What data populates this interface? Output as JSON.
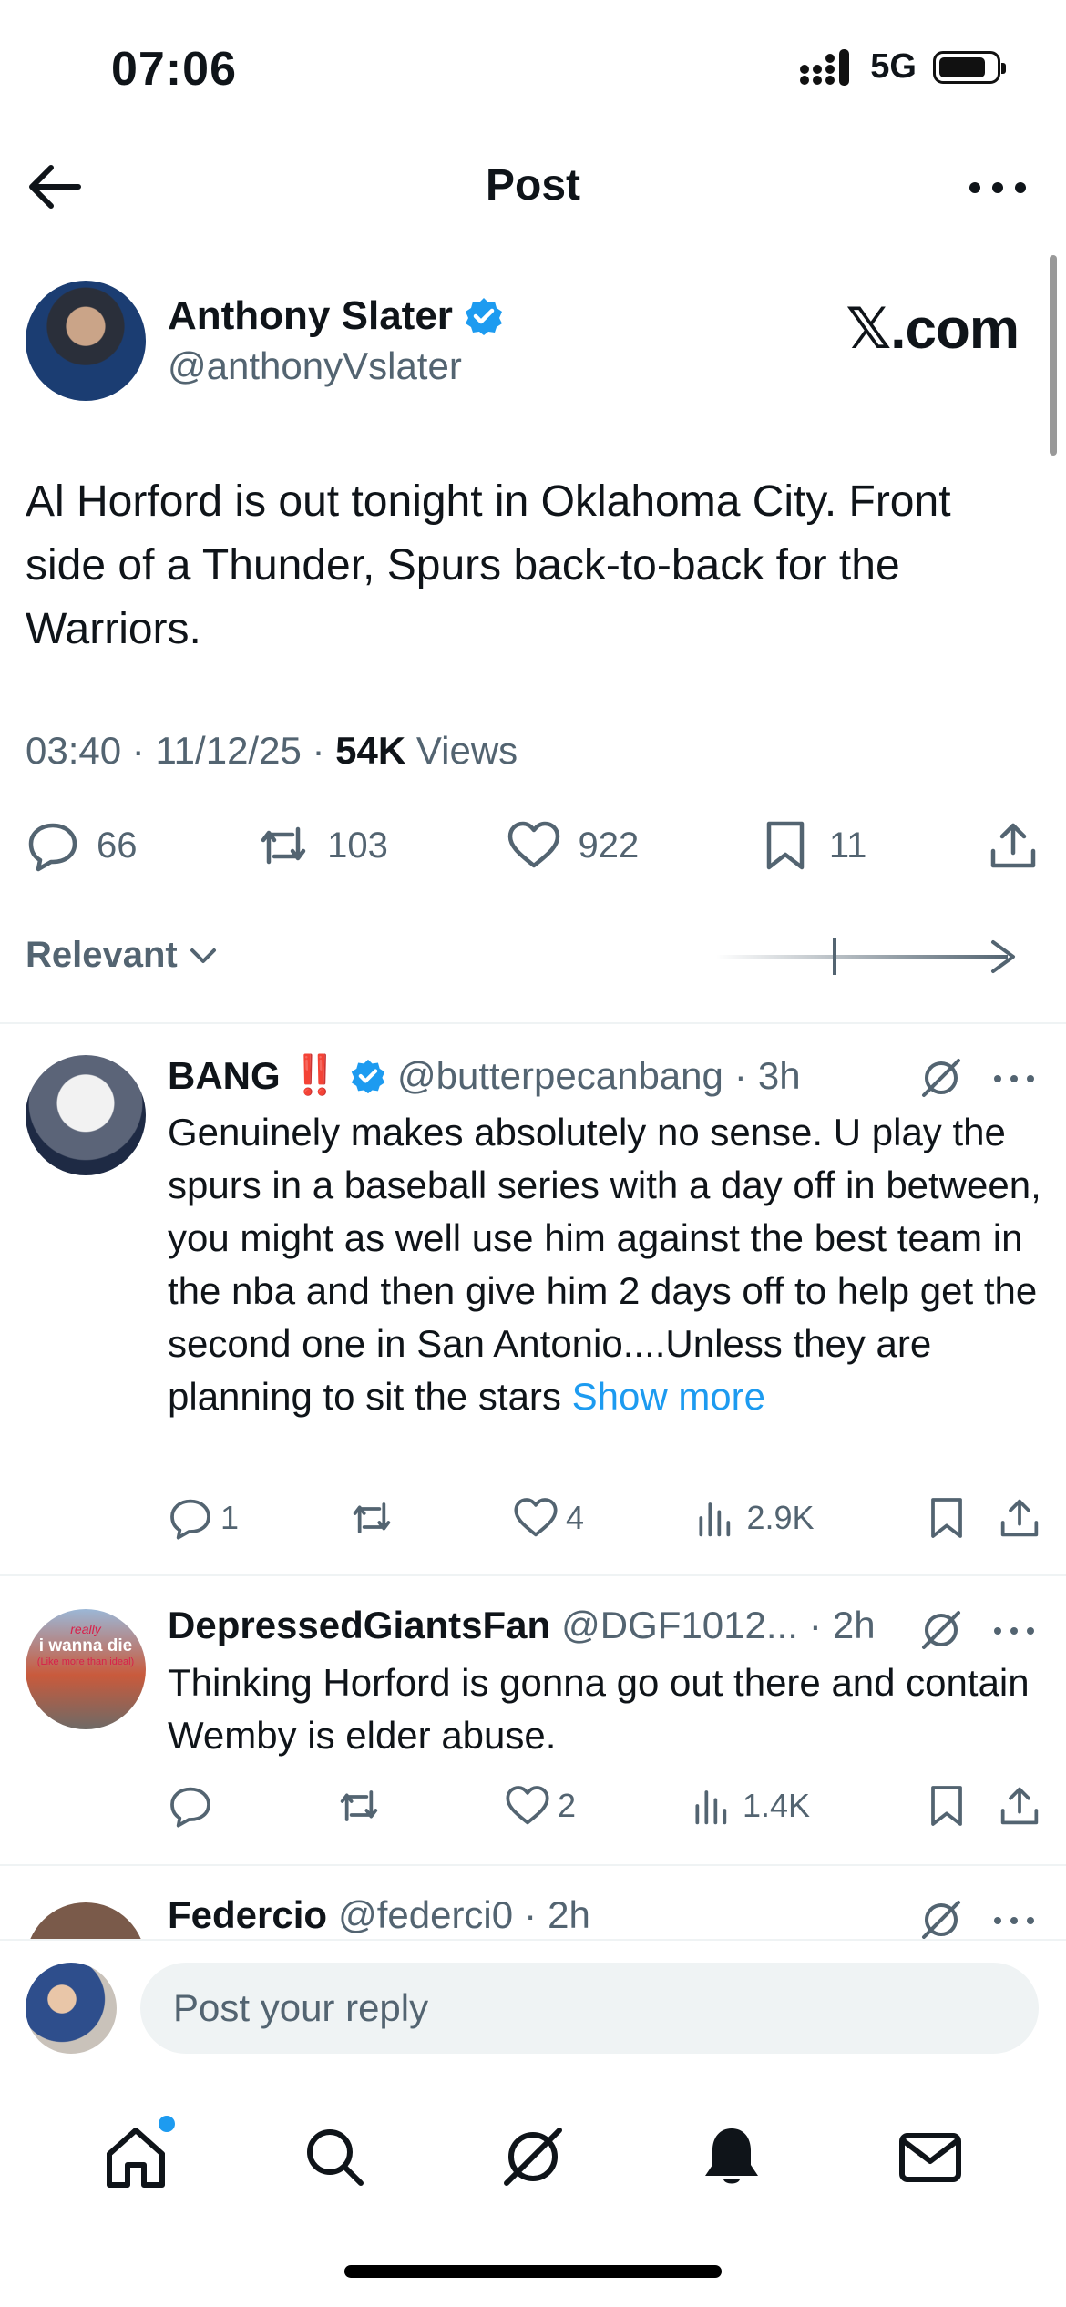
{
  "status_bar": {
    "time": "07:06",
    "network": "5G"
  },
  "header": {
    "title": "Post"
  },
  "post": {
    "author_name": "Anthony Slater",
    "author_handle": "@anthonyVslater",
    "watermark": "𝕏.com",
    "text": "Al Horford is out tonight in Oklahoma City. Front side of a Thunder, Spurs back-to-back for the Warriors.",
    "time": "03:40",
    "date": "11/12/25",
    "views_count": "54K",
    "views_label": "Views",
    "replies": "66",
    "reposts": "103",
    "likes": "922",
    "bookmarks": "11"
  },
  "sort": {
    "label": "Relevant"
  },
  "replies": [
    {
      "name": "BANG",
      "emoji": "‼️",
      "handle": "@butterpecanbang",
      "time": "3h",
      "text": "Genuinely makes absolutely no sense. U play the spurs in a baseball series with a day off in between, you might as well use him against the best team in the nba and then give him 2 days off to help get the second one in San Antonio....Unless they are planning to sit the stars",
      "show_more": "Show more",
      "replies": "1",
      "reposts": "",
      "likes": "4",
      "views": "2.9K"
    },
    {
      "name": "DepressedGiantsFan",
      "handle": "@DGF1012...",
      "time": "2h",
      "text": "Thinking Horford is gonna go out there and contain Wemby is elder abuse.",
      "replies": "",
      "reposts": "",
      "likes": "2",
      "views": "1.4K",
      "avatar_text_1": "really",
      "avatar_text_2": "i wanna die",
      "avatar_text_3": "(Like more than ideal)"
    },
    {
      "name": "Federcio",
      "handle": "@federci0",
      "time": "2h"
    }
  ],
  "reply_bar": {
    "placeholder": "Post your reply"
  },
  "colors": {
    "accent": "#1d9bf0",
    "text": "#0f1419",
    "muted": "#536471",
    "emoji_red": "#e0245e"
  }
}
